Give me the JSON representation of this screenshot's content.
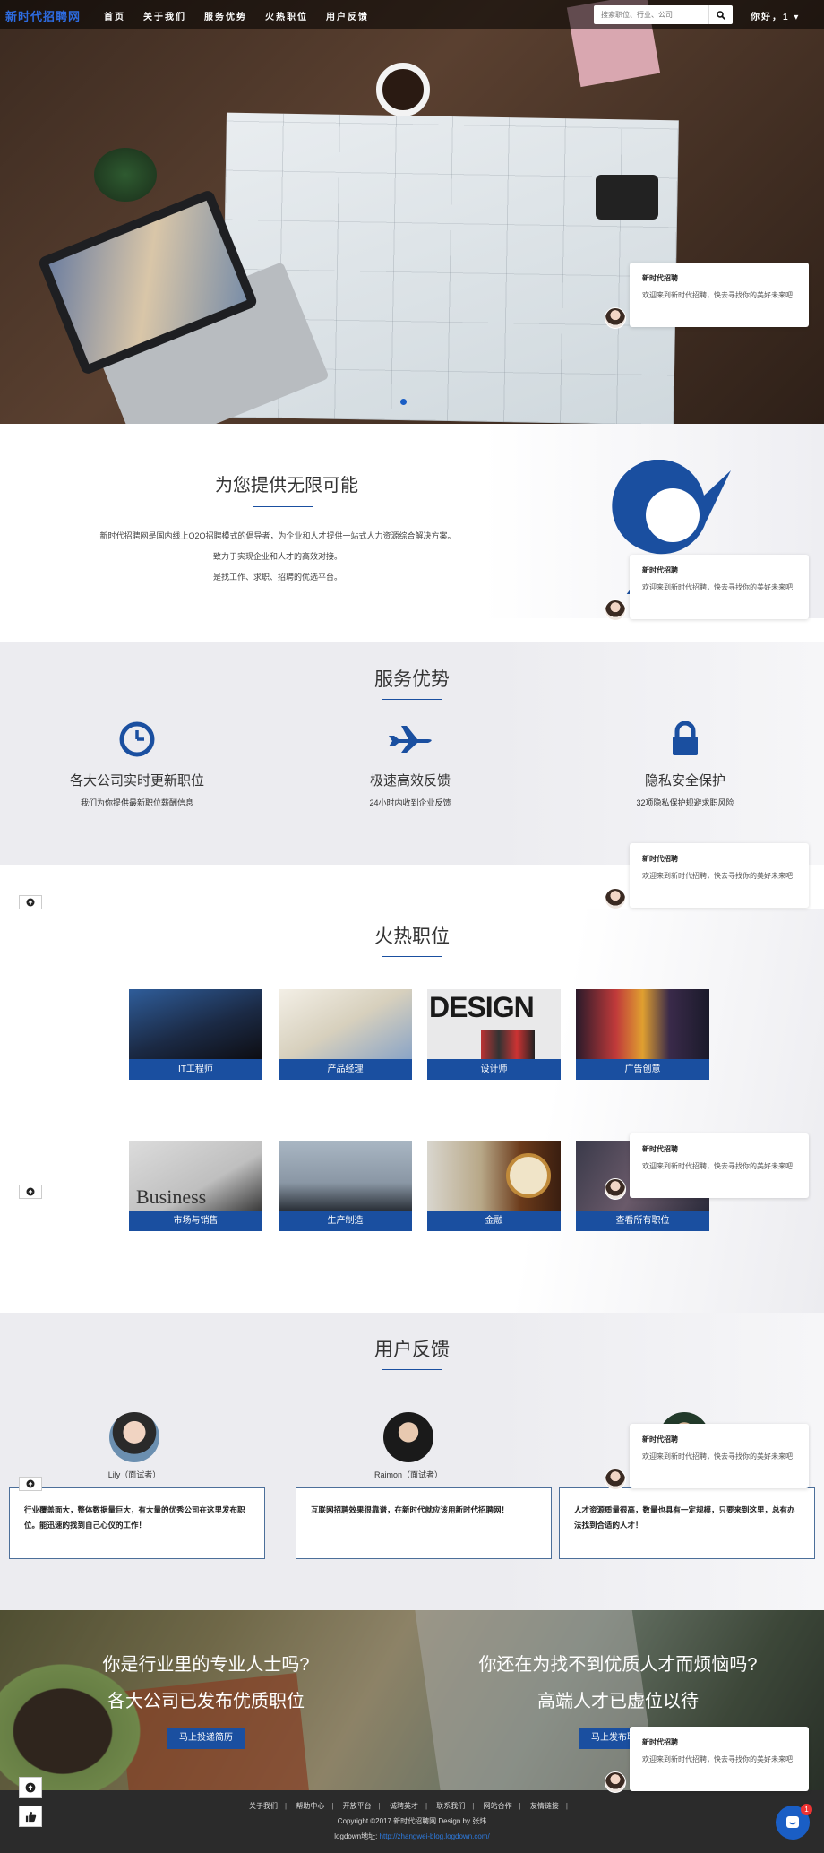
{
  "nav": {
    "brand": "新时代招聘网",
    "items": [
      "首页",
      "关于我们",
      "服务优势",
      "火热职位",
      "用户反馈"
    ],
    "search_placeholder": "搜索职位、行业、公司",
    "user_greeting": "你好，1 ▾"
  },
  "intro": {
    "title": "为您提供无限可能",
    "lines": [
      "新时代招聘网是国内线上O2O招聘模式的倡导者，为企业和人才提供一站式人力资源综合解决方案。",
      "致力于实现企业和人才的高效对接。",
      "是找工作、求职、招聘的优选平台。"
    ]
  },
  "services": {
    "title": "服务优势",
    "items": [
      {
        "icon": "clock-icon",
        "title": "各大公司实时更新职位",
        "desc": "我们为你提供最新职位薪酬信息"
      },
      {
        "icon": "plane-icon",
        "title": "极速高效反馈",
        "desc": "24小时内收到企业反馈"
      },
      {
        "icon": "lock-icon",
        "title": "隐私安全保护",
        "desc": "32项隐私保护规避求职风险"
      }
    ]
  },
  "jobs": {
    "title": "火热职位",
    "items": [
      "IT工程师",
      "产品经理",
      "设计师",
      "广告创意",
      "市场与销售",
      "生产制造",
      "金融",
      "查看所有职位"
    ],
    "design_word": "DESIGN",
    "business_word": "Business"
  },
  "feedback": {
    "title": "用户反馈",
    "items": [
      {
        "name": "Lily（面试者）",
        "text": "行业覆盖面大，整体数据量巨大，有大量的优秀公司在这里发布职位。能迅速的找到自己心仪的工作！"
      },
      {
        "name": "Raimon（面试者）",
        "text": "互联网招聘效果很靠谱，在新时代就应该用新时代招聘网！"
      },
      {
        "name": "",
        "text": "人才资源质量很高，数量也具有一定规模，只要来到这里，总有办法找到合适的人才！"
      }
    ]
  },
  "cta": {
    "left_q": "你是行业里的专业人士吗?",
    "left_s": "各大公司已发布优质职位",
    "left_btn": "马上投递简历",
    "right_q": "你还在为找不到优质人才而烦恼吗?",
    "right_s": "高端人才已虚位以待",
    "right_btn": "马上发布职位"
  },
  "footer": {
    "links": [
      "关于我们",
      "帮助中心",
      "开放平台",
      "诚聘英才",
      "联系我们",
      "网站合作",
      "友情链接"
    ],
    "copyright": "Copyright ©2017 新时代招聘网  Design by 张炜",
    "addr_label": "logdown地址:",
    "addr_url": "http://zhangwei-blog.logdown.com/"
  },
  "chat": {
    "title": "新时代招聘",
    "message": "欢迎来到新时代招聘，快去寻找你的美好未来吧"
  },
  "badge_count": "1",
  "colors": {
    "accent": "#1a4fa0",
    "brand": "#2d6be0",
    "footer_bg": "#2b2b2b"
  }
}
